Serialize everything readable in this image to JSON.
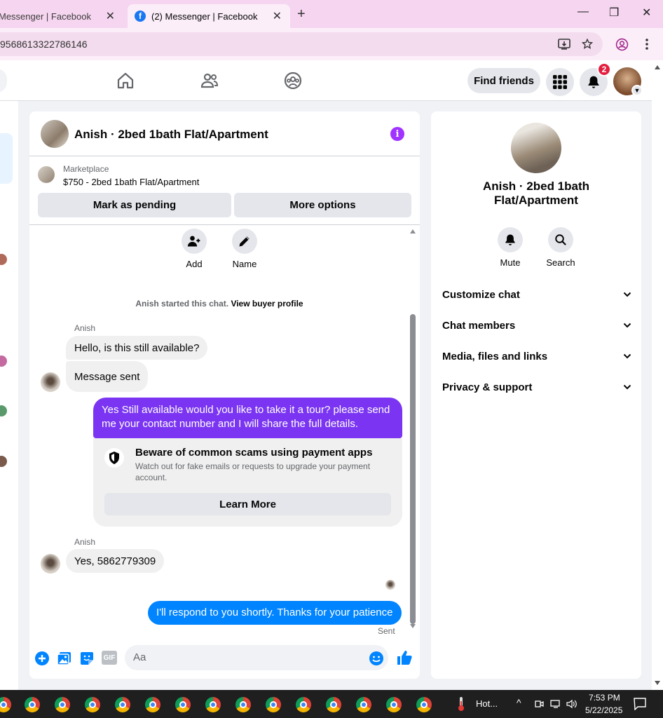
{
  "browser": {
    "tab1_title": "Messenger | Facebook",
    "tab2_title": "(2) Messenger | Facebook",
    "url": "9568613322786146"
  },
  "fb_nav": {
    "find_friends": "Find friends",
    "notification_count": "2"
  },
  "chat": {
    "title": "Anish · 2bed 1bath Flat/Apartment",
    "marketplace_label": "Marketplace",
    "listing": "$750 - 2bed 1bath Flat/Apartment",
    "mark_pending": "Mark as pending",
    "more_options": "More options",
    "actions": [
      {
        "label": "Add"
      },
      {
        "label": "Name"
      }
    ],
    "system_prefix": "Anish started this chat.",
    "system_link": "View buyer profile",
    "messages": [
      {
        "sender": "Anish",
        "text": "Hello, is this still available?"
      },
      {
        "text": "Message sent"
      },
      {
        "text": "Yes Still available would you like to take it a tour? please send me your contact number and I will share the full details."
      },
      {
        "sender": "Anish",
        "text": "Yes, 5862779309"
      },
      {
        "text": "I'll respond to you shortly. Thanks for your patience"
      }
    ],
    "scam_warning": {
      "title": "Beware of common scams using payment apps",
      "text": "Watch out for fake emails or requests to upgrade your payment account.",
      "button": "Learn More"
    },
    "sent_status": "Sent",
    "composer_placeholder": "Aa",
    "gif_label": "GIF"
  },
  "info_panel": {
    "name": "Anish · 2bed 1bath Flat/Apartment",
    "name_line1": "Anish · 2bed 1bath",
    "name_line2": "Flat/Apartment",
    "mute": "Mute",
    "search": "Search",
    "sections": [
      "Customize chat",
      "Chat members",
      "Media, files and links",
      "Privacy & support"
    ]
  },
  "taskbar": {
    "weather": "Hot...",
    "time": "7:53 PM",
    "date": "5/22/2025"
  },
  "colors": {
    "accent_blue": "#0084ff",
    "message_purple": "#7b35f2",
    "fb_blue": "#1877f2",
    "info_purple": "#a033ff"
  }
}
